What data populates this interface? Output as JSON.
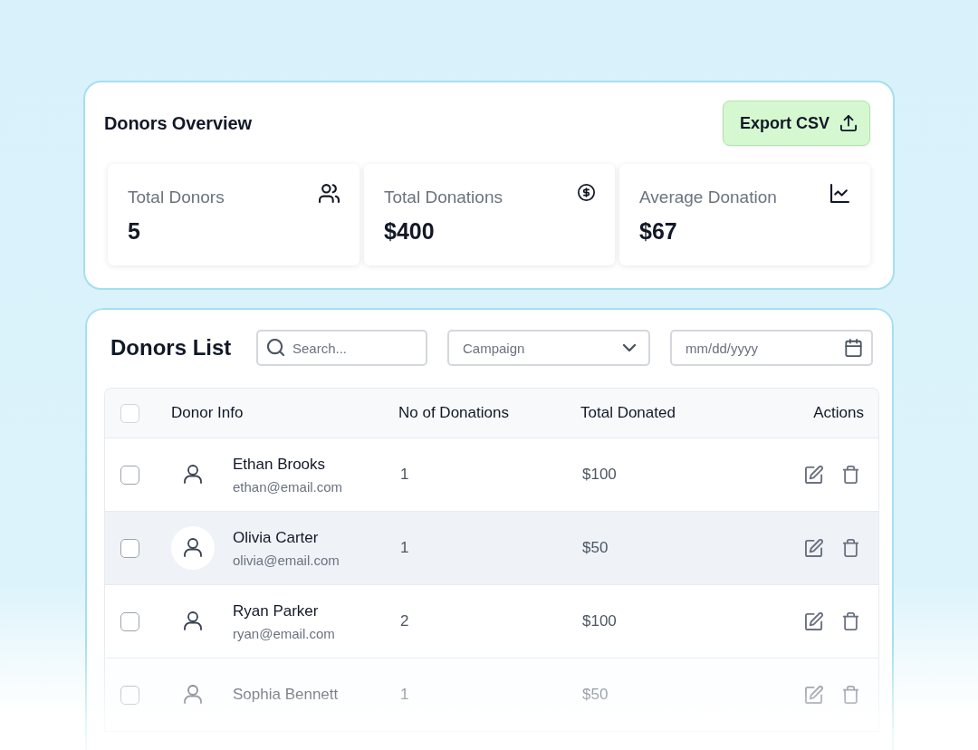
{
  "overview": {
    "title": "Donors Overview",
    "export_button": "Export CSV",
    "stats": [
      {
        "label": "Total Donors",
        "value": "5"
      },
      {
        "label": "Total Donations",
        "value": "$400"
      },
      {
        "label": "Average Donation",
        "value": "$67"
      }
    ]
  },
  "donors_list": {
    "title": "Donors List",
    "search": {
      "placeholder": "Search..."
    },
    "campaign_select": {
      "placeholder": "Campaign"
    },
    "date_field": {
      "placeholder": "mm/dd/yyyy"
    },
    "table": {
      "select_all": {
        "checked": false
      },
      "columns": [
        "Donor Info",
        "No of Donations",
        "Total Donated",
        "Actions"
      ],
      "rows": [
        {
          "name": "Ethan Brooks",
          "email": "ethan@email.com",
          "donations": "1",
          "total": "$100",
          "checked": false,
          "highlighted": false
        },
        {
          "name": "Olivia Carter",
          "email": "olivia@email.com",
          "donations": "1",
          "total": "$50",
          "checked": false,
          "highlighted": true
        },
        {
          "name": "Ryan Parker",
          "email": "ryan@email.com",
          "donations": "2",
          "total": "$100",
          "checked": false,
          "highlighted": false
        },
        {
          "name": "Sophia Bennett",
          "donations": "1",
          "total": "$50",
          "checked": false,
          "highlighted": false
        }
      ]
    }
  }
}
